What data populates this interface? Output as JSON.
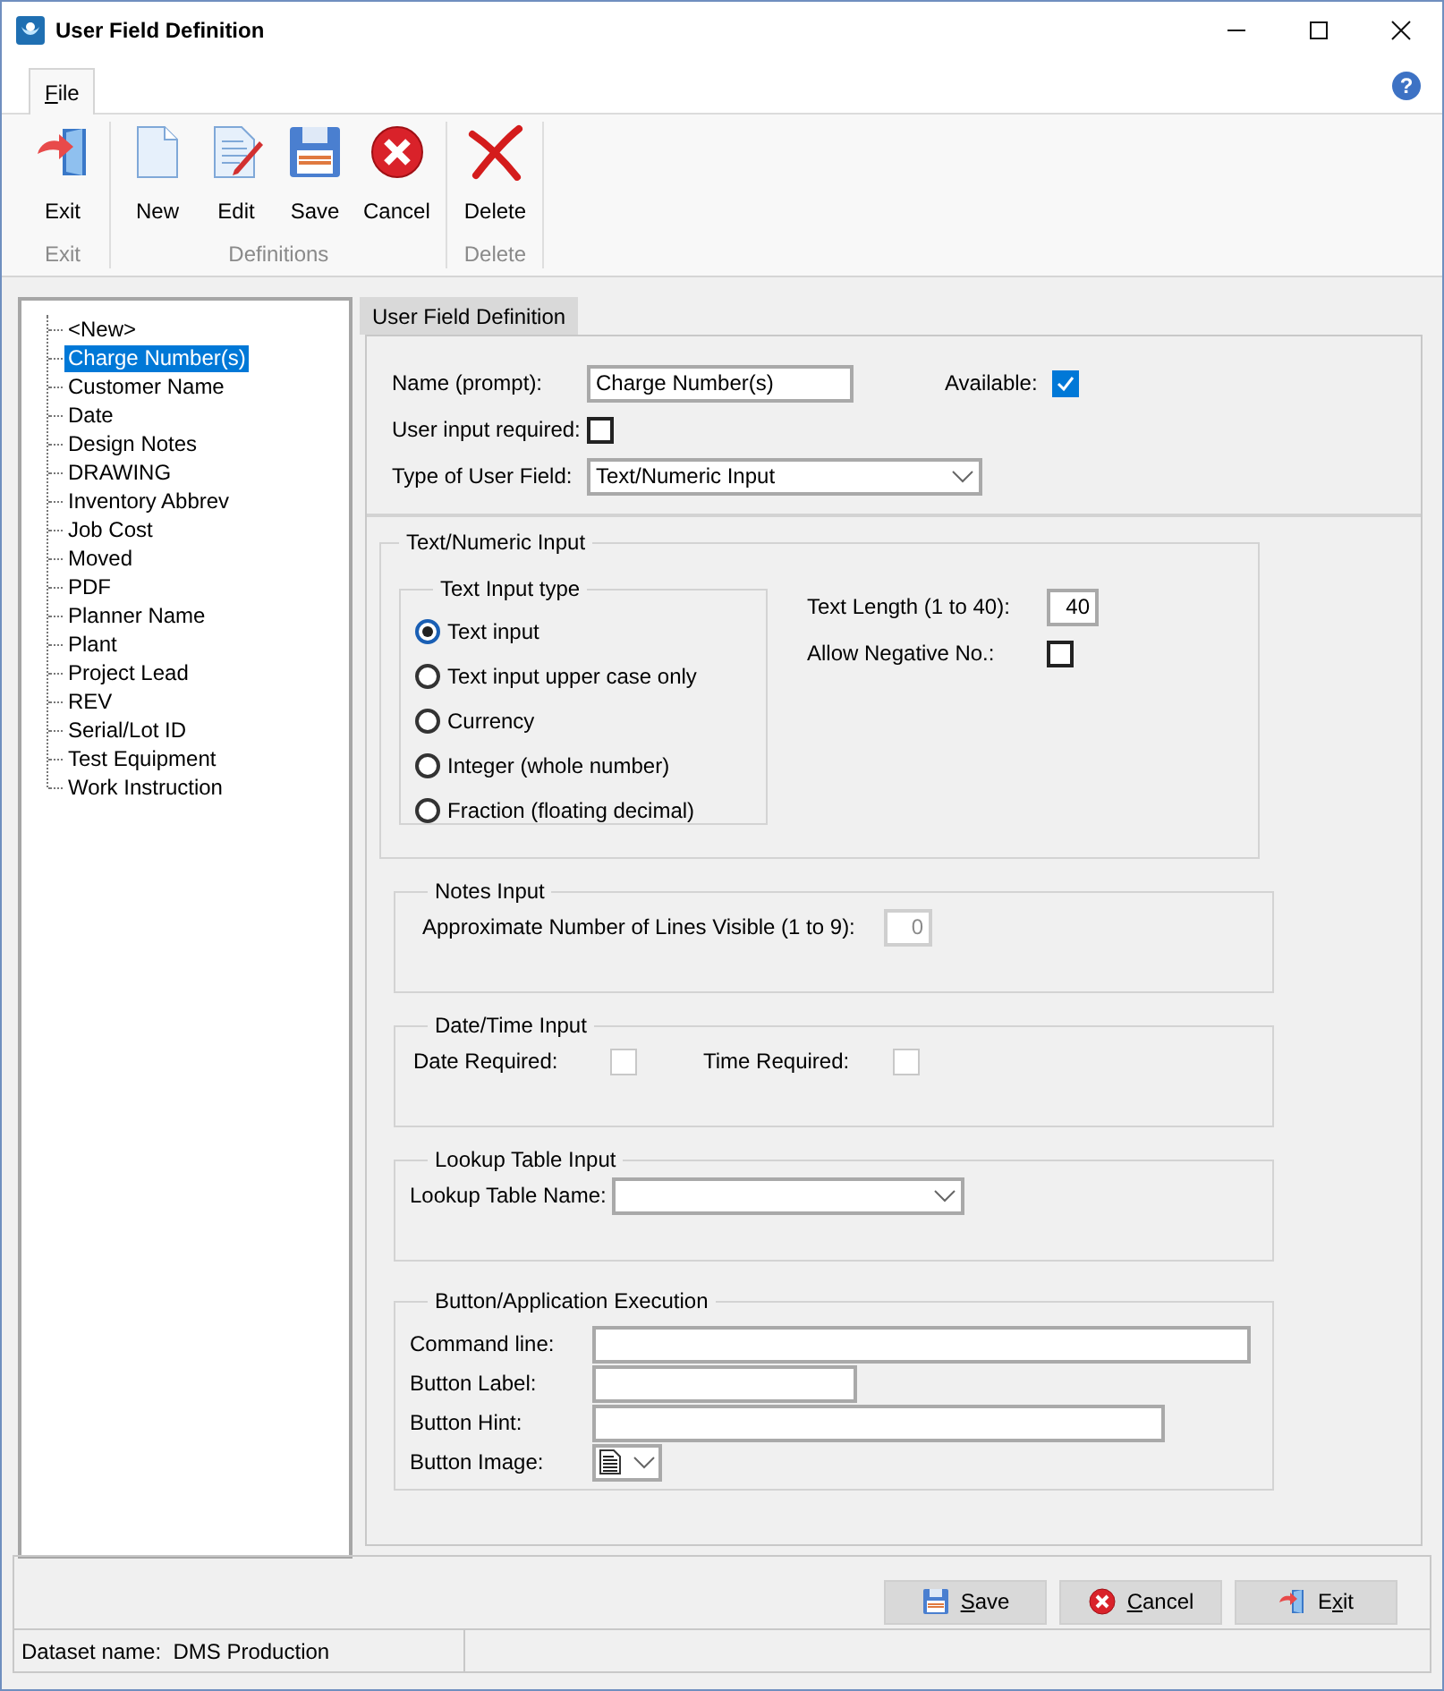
{
  "window": {
    "title": "User Field Definition"
  },
  "menu_tabs": [
    {
      "label": "File",
      "selected": true
    }
  ],
  "help": {
    "label": "?"
  },
  "ribbon_groups": [
    {
      "label": "Exit",
      "buttons": [
        {
          "label": "Exit",
          "kind": "exit"
        }
      ]
    },
    {
      "label": "Definitions",
      "buttons": [
        {
          "label": "New",
          "kind": "new"
        },
        {
          "label": "Edit",
          "kind": "edit"
        },
        {
          "label": "Save",
          "kind": "save"
        },
        {
          "label": "Cancel",
          "kind": "cancel"
        }
      ]
    },
    {
      "label": "Delete",
      "buttons": [
        {
          "label": "Delete",
          "kind": "delete"
        }
      ]
    }
  ],
  "tree": {
    "items": [
      {
        "label": "<New>",
        "selected": false
      },
      {
        "label": "Charge Number(s)",
        "selected": true
      },
      {
        "label": "Customer Name",
        "selected": false
      },
      {
        "label": "Date",
        "selected": false
      },
      {
        "label": "Design Notes",
        "selected": false
      },
      {
        "label": "DRAWING",
        "selected": false
      },
      {
        "label": "Inventory Abbrev",
        "selected": false
      },
      {
        "label": "Job Cost",
        "selected": false
      },
      {
        "label": "Moved",
        "selected": false
      },
      {
        "label": "PDF",
        "selected": false
      },
      {
        "label": "Planner Name",
        "selected": false
      },
      {
        "label": "Plant",
        "selected": false
      },
      {
        "label": "Project Lead",
        "selected": false
      },
      {
        "label": "REV",
        "selected": false
      },
      {
        "label": "Serial/Lot ID",
        "selected": false
      },
      {
        "label": "Test Equipment",
        "selected": false
      },
      {
        "label": "Work Instruction",
        "selected": false
      }
    ]
  },
  "panel_tab": {
    "label": "User Field Definition"
  },
  "form": {
    "name_label": "Name (prompt):",
    "name_value": "Charge Number(s)",
    "available_label": "Available:",
    "available_checked": true,
    "required_label": "User input required:",
    "required_checked": false,
    "type_label": "Type of User Field:",
    "type_value": "Text/Numeric Input"
  },
  "text_numeric": {
    "title": "Text/Numeric Input",
    "input_type": {
      "title": "Text Input type",
      "options": [
        {
          "label": "Text input",
          "selected": true
        },
        {
          "label": "Text input upper case only",
          "selected": false
        },
        {
          "label": "Currency",
          "selected": false
        },
        {
          "label": "Integer (whole number)",
          "selected": false
        },
        {
          "label": "Fraction (floating decimal)",
          "selected": false
        }
      ]
    },
    "length_label": "Text Length (1 to 40):",
    "length_value": "40",
    "negative_label": "Allow Negative No.:",
    "negative_checked": false
  },
  "notes": {
    "title": "Notes Input",
    "lines_label": "Approximate Number of Lines Visible (1 to 9):",
    "lines_value": "0",
    "disabled": true
  },
  "date_time": {
    "title": "Date/Time Input",
    "date_label": "Date Required:",
    "date_checked": false,
    "time_label": "Time Required:",
    "time_checked": false,
    "disabled": true
  },
  "lookup": {
    "title": "Lookup Table Input",
    "name_label": "Lookup Table Name:"
  },
  "button_exec": {
    "title": "Button/Application Execution",
    "fields": [
      {
        "label": "Command line:"
      },
      {
        "label": "Button Label:"
      },
      {
        "label": "Button Hint:"
      }
    ],
    "image_label": "Button Image:"
  },
  "footer_buttons": [
    {
      "label": "Save",
      "kind": "save"
    },
    {
      "label": "Cancel",
      "kind": "cancel"
    },
    {
      "label": "Exit",
      "kind": "exit"
    }
  ],
  "status_bar": {
    "text": "Dataset name:  DMS Production"
  }
}
